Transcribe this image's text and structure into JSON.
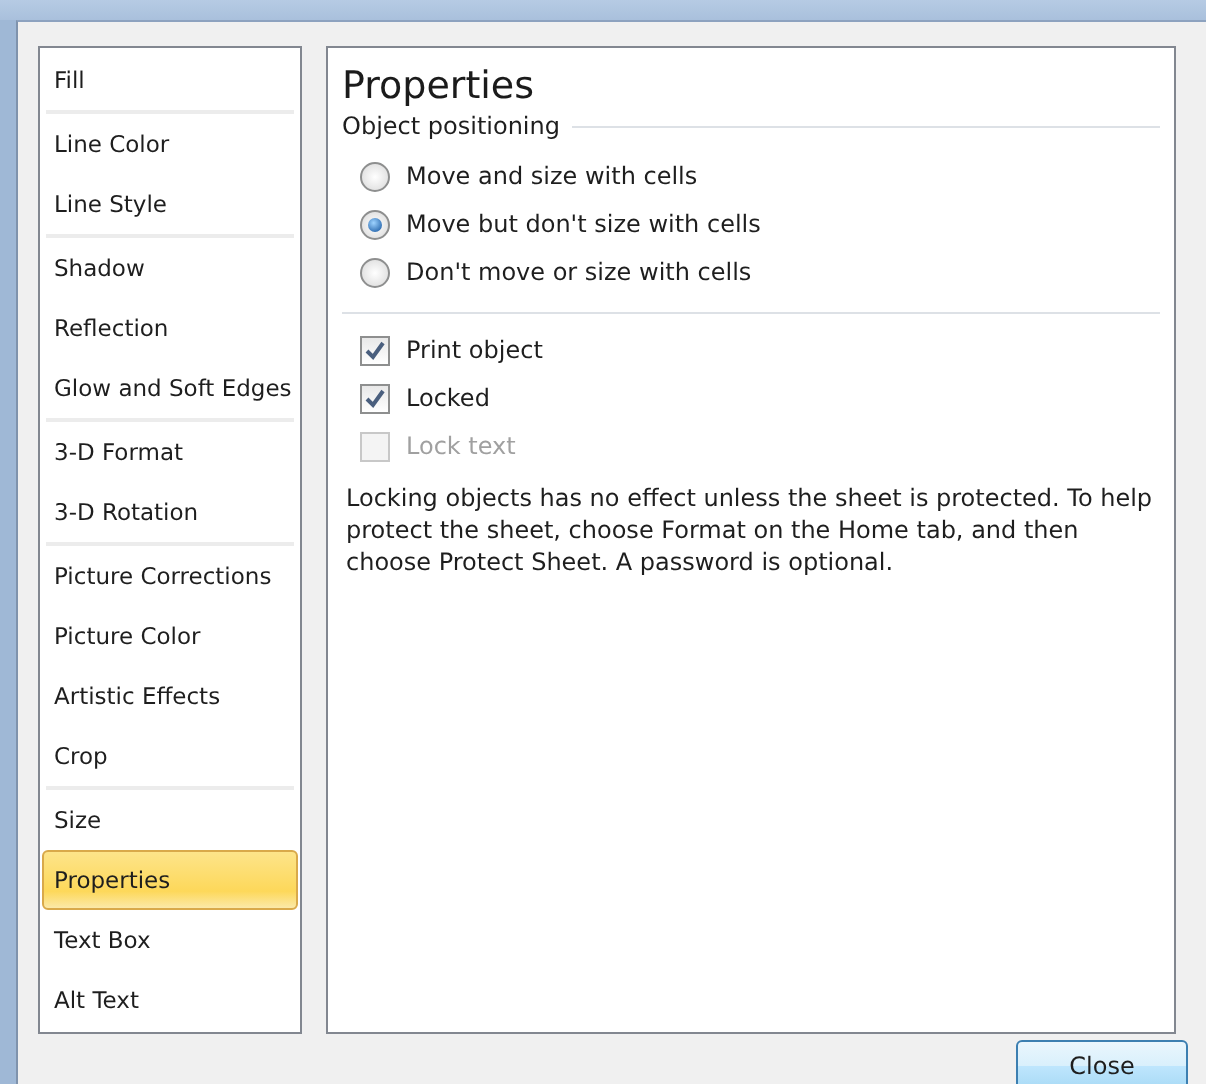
{
  "sidebar": {
    "groups": [
      {
        "items": [
          {
            "label": "Fill",
            "selected": false
          }
        ]
      },
      {
        "items": [
          {
            "label": "Line Color",
            "selected": false
          },
          {
            "label": "Line Style",
            "selected": false
          }
        ]
      },
      {
        "items": [
          {
            "label": "Shadow",
            "selected": false
          },
          {
            "label": "Reflection",
            "selected": false
          },
          {
            "label": "Glow and Soft Edges",
            "selected": false
          }
        ]
      },
      {
        "items": [
          {
            "label": "3-D Format",
            "selected": false
          },
          {
            "label": "3-D Rotation",
            "selected": false
          }
        ]
      },
      {
        "items": [
          {
            "label": "Picture Corrections",
            "selected": false
          },
          {
            "label": "Picture Color",
            "selected": false
          },
          {
            "label": "Artistic Effects",
            "selected": false
          },
          {
            "label": "Crop",
            "selected": false
          }
        ]
      },
      {
        "items": [
          {
            "label": "Size",
            "selected": false
          },
          {
            "label": "Properties",
            "selected": true
          },
          {
            "label": "Text Box",
            "selected": false
          },
          {
            "label": "Alt Text",
            "selected": false
          }
        ]
      }
    ]
  },
  "panel": {
    "title": "Properties",
    "section": "Object positioning",
    "radios": [
      {
        "label": "Move and size with cells",
        "selected": false
      },
      {
        "label": "Move but don't size with cells",
        "selected": true
      },
      {
        "label": "Don't move or size with cells",
        "selected": false
      }
    ],
    "checkboxes": [
      {
        "label": "Print object",
        "checked": true,
        "disabled": false
      },
      {
        "label": "Locked",
        "checked": true,
        "disabled": false
      },
      {
        "label": "Lock text",
        "checked": false,
        "disabled": true
      }
    ],
    "note": "Locking objects has no effect unless the sheet is protected. To help protect the sheet, choose Format on the Home tab, and then choose Protect Sheet. A password is optional."
  },
  "buttons": [
    "Close"
  ]
}
